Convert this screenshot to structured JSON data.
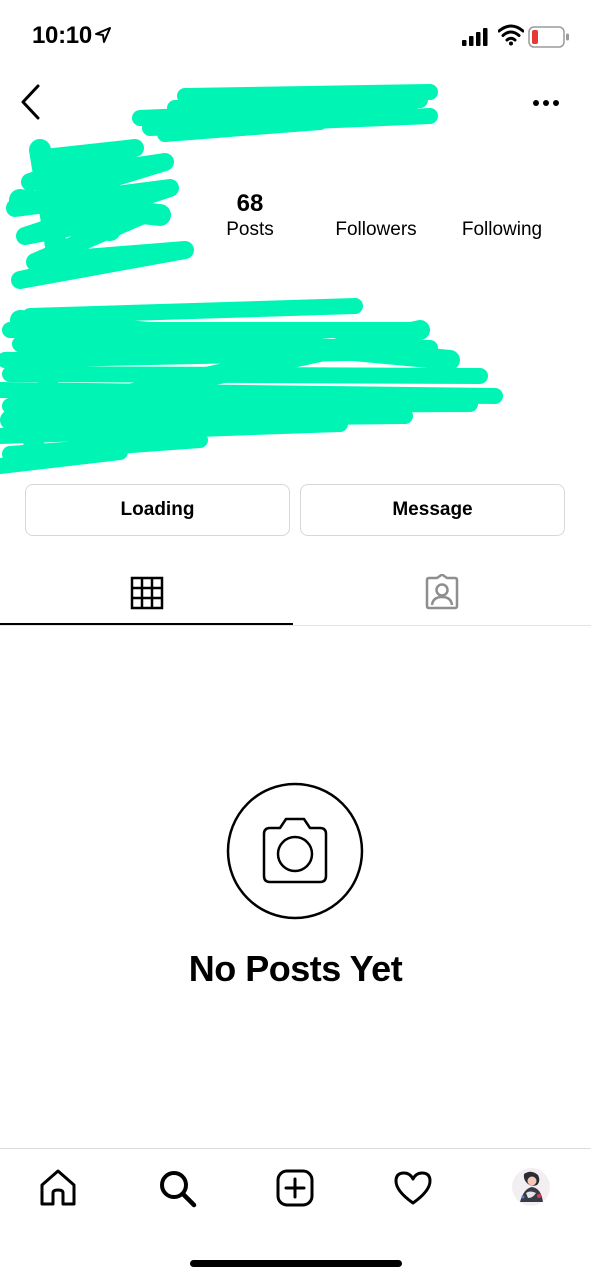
{
  "status_bar": {
    "time": "10:10"
  },
  "profile": {
    "posts_count": "68",
    "posts_label": "Posts",
    "followers_label": "Followers",
    "following_label": "Following"
  },
  "actions": {
    "loading_label": "Loading",
    "message_label": "Message"
  },
  "tabs": [
    {
      "icon": "grid-icon",
      "active": true
    },
    {
      "icon": "tagged-icon",
      "active": false
    }
  ],
  "empty_state": {
    "title": "No Posts Yet",
    "icon": "camera-icon"
  },
  "bottom_nav": [
    "home-icon",
    "search-icon",
    "add-post-icon",
    "heart-icon",
    "profile-avatar"
  ],
  "colors": {
    "scribble": "#00f5b4",
    "battery_low": "#e53935",
    "divider": "#e4e4e4"
  }
}
